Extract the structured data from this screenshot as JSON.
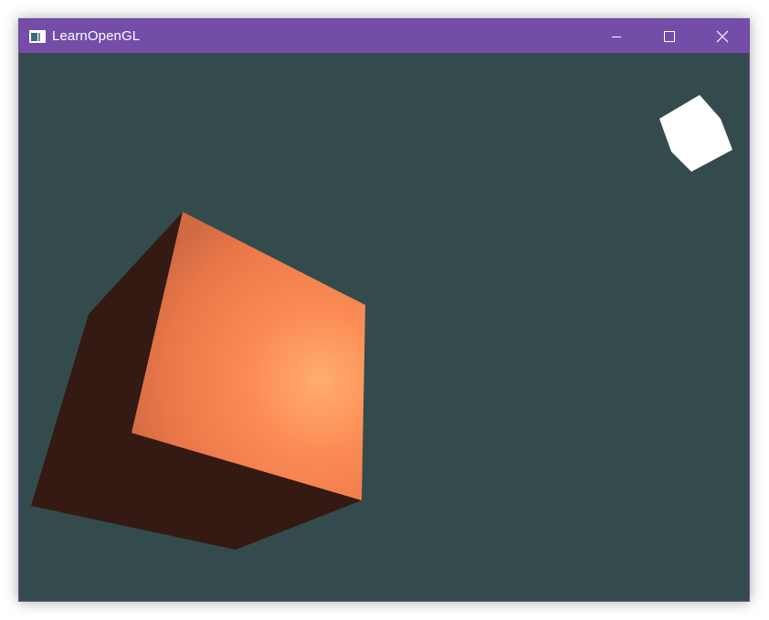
{
  "window": {
    "title": "LearnOpenGL",
    "colors": {
      "titlebar": "#744da9",
      "clear_color": "#334b4d",
      "cube_lit": "#fd9f6a",
      "cube_mid": "#f47c4c",
      "cube_edge": "#d26a42",
      "cube_shadow": "#341a13",
      "light_cube": "#ffffff"
    },
    "icons": {
      "app": "opengl-window-icon",
      "minimize": "minimize-icon",
      "maximize": "maximize-icon",
      "close": "close-icon"
    }
  }
}
